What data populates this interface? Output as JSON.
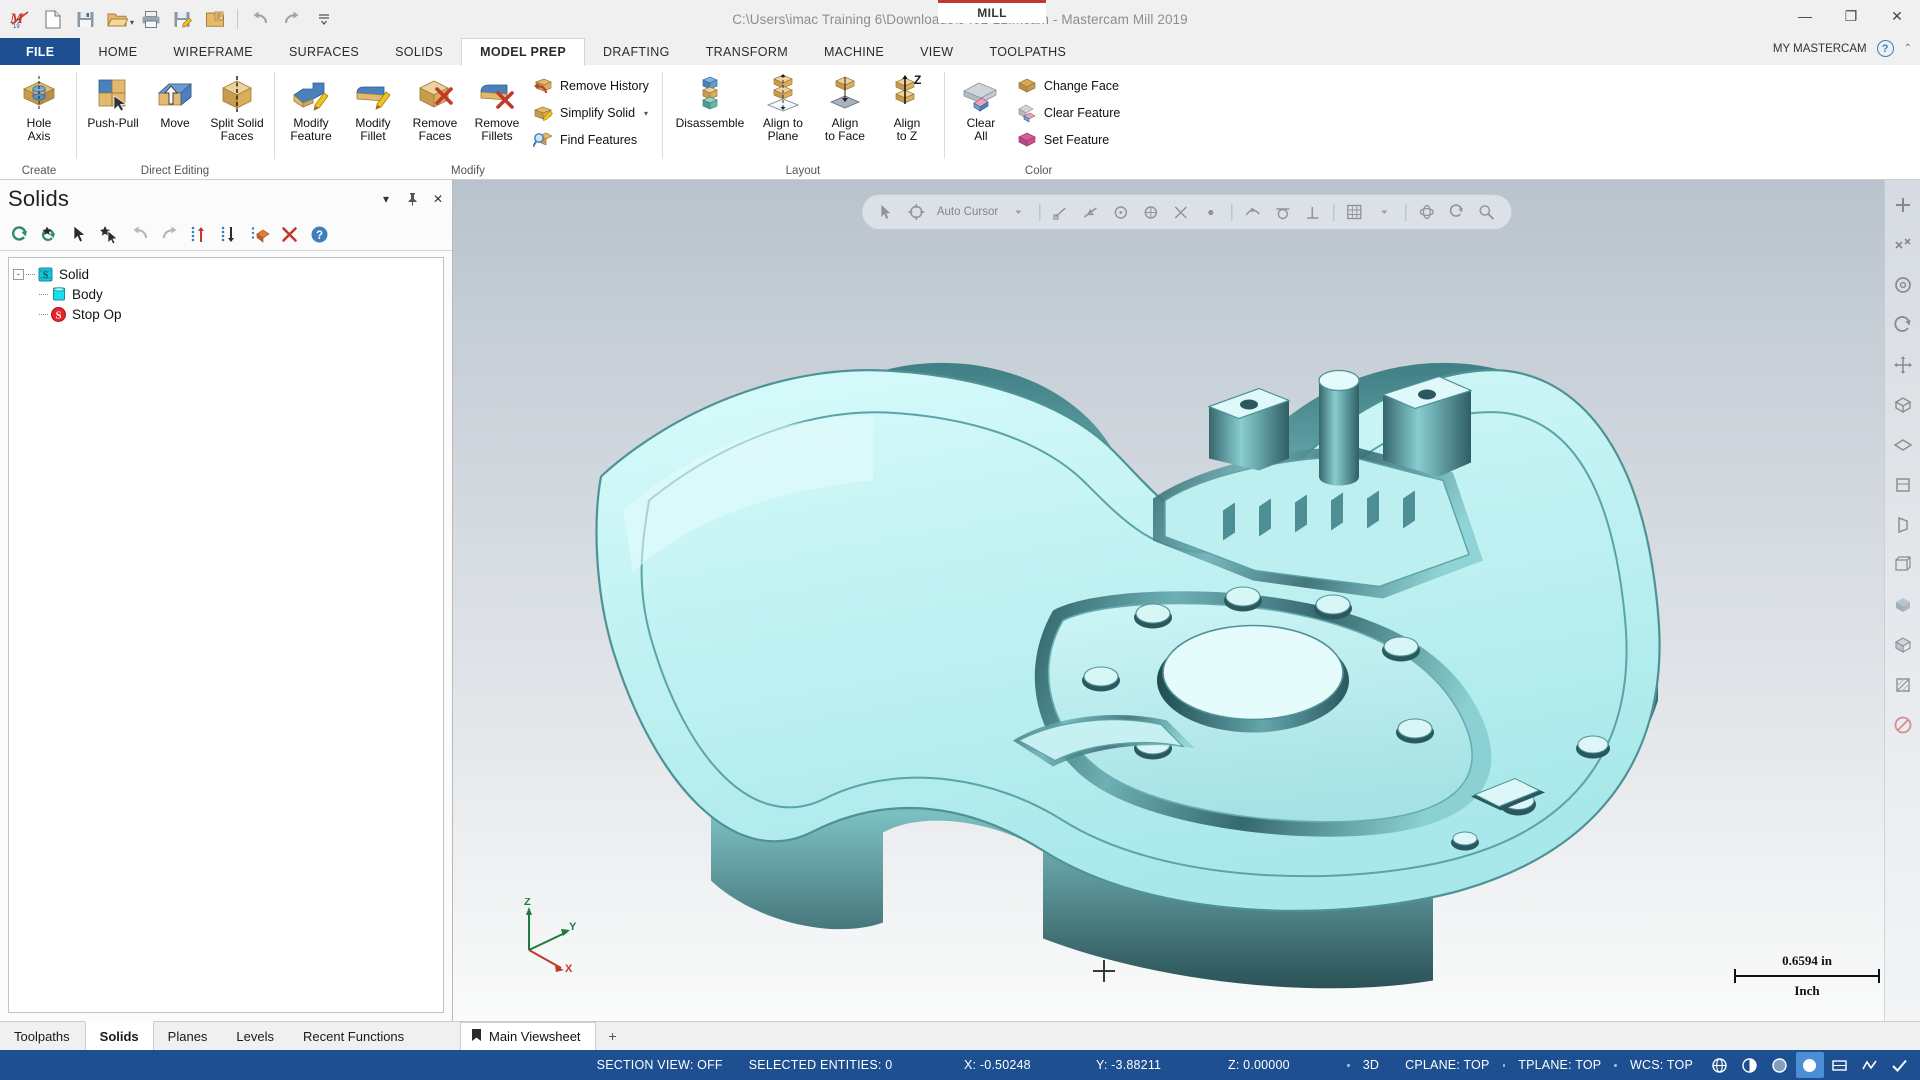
{
  "window": {
    "title": "C:\\Users\\imac Training 6\\Downloads\\9401-21.mcam - Mastercam Mill 2019",
    "machine_tab": "MILL",
    "minimize": "—",
    "maximize": "❐",
    "close": "✕"
  },
  "quick_access": [
    {
      "name": "mastercam-logo-icon",
      "label": "Mastercam"
    },
    {
      "name": "new-file-icon",
      "label": "New"
    },
    {
      "name": "save-icon",
      "label": "Save"
    },
    {
      "name": "open-folder-icon",
      "label": "Open"
    },
    {
      "name": "print-icon",
      "label": "Print"
    },
    {
      "name": "save-as-icon",
      "label": "Save As"
    },
    {
      "name": "folder-options-icon",
      "label": "Open Recent"
    },
    {
      "name": "undo-icon",
      "label": "Undo"
    },
    {
      "name": "redo-icon",
      "label": "Redo"
    },
    {
      "name": "customize-qat-icon",
      "label": "Customize Quick Access Toolbar"
    }
  ],
  "ribbon": {
    "tabs": [
      {
        "label": "FILE",
        "type": "file"
      },
      {
        "label": "HOME",
        "type": "normal"
      },
      {
        "label": "WIREFRAME",
        "type": "normal"
      },
      {
        "label": "SURFACES",
        "type": "normal"
      },
      {
        "label": "SOLIDS",
        "type": "normal"
      },
      {
        "label": "MODEL PREP",
        "type": "active"
      },
      {
        "label": "DRAFTING",
        "type": "normal"
      },
      {
        "label": "TRANSFORM",
        "type": "normal"
      },
      {
        "label": "MACHINE",
        "type": "normal"
      },
      {
        "label": "VIEW",
        "type": "normal"
      },
      {
        "label": "TOOLPATHS",
        "type": "normal"
      }
    ],
    "account_label": "MY MASTERCAM",
    "help_label": "?",
    "collapse_label": "⌃",
    "groups": [
      {
        "name": "create",
        "label": "Create",
        "buttons": [
          {
            "label": "Hole\nAxis",
            "line1": "Hole",
            "line2": "Axis",
            "icon": "hole-axis-icon"
          }
        ]
      },
      {
        "name": "direct-editing",
        "label": "Direct Editing",
        "buttons": [
          {
            "line1": "Push-Pull",
            "line2": "",
            "icon": "push-pull-icon"
          },
          {
            "line1": "Move",
            "line2": "",
            "icon": "move-icon"
          },
          {
            "line1": "Split Solid",
            "line2": "Faces",
            "icon": "split-solid-faces-icon"
          }
        ]
      },
      {
        "name": "modify",
        "label": "Modify",
        "buttons": [
          {
            "line1": "Modify",
            "line2": "Feature",
            "icon": "modify-feature-icon"
          },
          {
            "line1": "Modify",
            "line2": "Fillet",
            "icon": "modify-fillet-icon"
          },
          {
            "line1": "Remove",
            "line2": "Faces",
            "icon": "remove-faces-icon"
          },
          {
            "line1": "Remove",
            "line2": "Fillets",
            "icon": "remove-fillets-icon"
          }
        ],
        "small_buttons": [
          {
            "label": "Remove History",
            "icon": "remove-history-icon",
            "dropdown": false
          },
          {
            "label": "Simplify Solid",
            "icon": "simplify-solid-icon",
            "dropdown": true
          },
          {
            "label": "Find Features",
            "icon": "find-features-icon",
            "dropdown": false
          }
        ]
      },
      {
        "name": "layout",
        "label": "Layout",
        "buttons": [
          {
            "line1": "Disassemble",
            "line2": "",
            "icon": "disassemble-icon"
          },
          {
            "line1": "Align to",
            "line2": "Plane",
            "icon": "align-to-plane-icon"
          },
          {
            "line1": "Align",
            "line2": "to Face",
            "icon": "align-to-face-icon"
          },
          {
            "line1": "Align",
            "line2": "to Z",
            "icon": "align-to-z-icon"
          }
        ]
      },
      {
        "name": "color",
        "label": "Color",
        "buttons": [
          {
            "line1": "Clear",
            "line2": "All",
            "icon": "clear-all-icon"
          }
        ],
        "small_buttons": [
          {
            "label": "Change Face",
            "icon": "change-face-icon",
            "dropdown": false
          },
          {
            "label": "Clear Feature",
            "icon": "clear-feature-icon",
            "dropdown": false
          },
          {
            "label": "Set Feature",
            "icon": "set-feature-icon",
            "dropdown": false
          }
        ]
      }
    ]
  },
  "solids_panel": {
    "title": "Solids",
    "header_buttons": [
      {
        "name": "panel-dropdown-icon",
        "glyph": "▾"
      },
      {
        "name": "pin-icon",
        "glyph": "📌"
      },
      {
        "name": "close-panel-icon",
        "glyph": "✕"
      }
    ],
    "toolbar": [
      {
        "name": "regenerate-all-icon",
        "label": "Regenerate all dirty operations"
      },
      {
        "name": "regenerate-selected-icon",
        "label": "Regenerate selected dirty operations"
      },
      {
        "name": "select-icon",
        "label": "Select"
      },
      {
        "name": "select-all-icon",
        "label": "Select all"
      },
      {
        "name": "undo-icon",
        "label": "Undo"
      },
      {
        "name": "redo-icon",
        "label": "Redo"
      },
      {
        "name": "move-up-icon",
        "label": "Move up"
      },
      {
        "name": "move-down-icon",
        "label": "Move down"
      },
      {
        "name": "solid-properties-icon",
        "label": "Solid properties"
      },
      {
        "name": "delete-icon",
        "label": "Delete"
      },
      {
        "name": "help-icon",
        "label": "Help"
      }
    ],
    "tree": [
      {
        "label": "Solid",
        "icon": "solid-icon",
        "level": 0,
        "expander": "-"
      },
      {
        "label": "Body",
        "icon": "body-icon",
        "level": 1,
        "expander": ""
      },
      {
        "label": "Stop Op",
        "icon": "stop-op-icon",
        "level": 1,
        "expander": ""
      }
    ]
  },
  "viewport": {
    "toolbar_label": "Auto Cursor",
    "toolbar_icons": [
      "cursor-snap-icon",
      "autocursor-icon",
      "dropdown-icon",
      "snap-endpoint-icon",
      "snap-midpoint-icon",
      "snap-center-icon",
      "snap-quadrant-icon",
      "snap-intersection-icon",
      "snap-point-icon",
      "snap-nearest-icon",
      "snap-tangent-icon",
      "snap-perpendicular-icon",
      "grid-icon",
      "grid-dropdown-icon",
      "rotate-view-icon",
      "fit-view-icon",
      "unzoom-icon"
    ],
    "right_rail_icons": [
      "zoom-in-icon",
      "zoom-window-icon",
      "fit-screen-icon",
      "dynamic-rotate-icon",
      "pan-icon",
      "isometric-view-icon",
      "top-view-icon",
      "front-view-icon",
      "right-view-icon",
      "wireframe-icon",
      "shaded-icon",
      "shaded-wireframe-icon",
      "section-view-icon",
      "no-section-icon"
    ],
    "axis_gizmo": {
      "x": "X",
      "y": "Y",
      "z": "Z"
    },
    "scale": {
      "value": "0.6594 in",
      "unit": "Inch"
    }
  },
  "bottom_tabs": {
    "left": [
      {
        "label": "Toolpaths",
        "active": false
      },
      {
        "label": "Solids",
        "active": true
      },
      {
        "label": "Planes",
        "active": false
      },
      {
        "label": "Levels",
        "active": false
      },
      {
        "label": "Recent Functions",
        "active": false
      }
    ],
    "viewsheet": {
      "label": "Main Viewsheet",
      "icon": "viewsheet-icon"
    },
    "add_viewsheet": "+"
  },
  "statusbar": {
    "section_view": "SECTION VIEW: OFF",
    "selected_entities": "SELECTED ENTITIES: 0",
    "x": "X:  -0.50248",
    "y": "Y:  -3.88211",
    "z": "Z:  0.00000",
    "mode": "3D",
    "cplane": "CPLANE: TOP",
    "tplane": "TPLANE: TOP",
    "wcs": "WCS: TOP",
    "right_icons": [
      {
        "name": "wireframe-display-icon",
        "active": false
      },
      {
        "name": "shaded-display-icon",
        "active": false
      },
      {
        "name": "translucent-display-icon",
        "active": false
      },
      {
        "name": "material-display-icon",
        "active": true
      },
      {
        "name": "edges-display-icon",
        "active": false
      },
      {
        "name": "backplot-icon",
        "active": false
      },
      {
        "name": "verify-icon",
        "active": false
      }
    ]
  },
  "colors": {
    "accent_blue": "#1d4f91",
    "ribbon_bg": "#ffffff",
    "model_light": "#c8f3f4",
    "model_dark": "#2f6166",
    "status_bar": "#1d4f91",
    "red_accent": "#c0392b"
  }
}
